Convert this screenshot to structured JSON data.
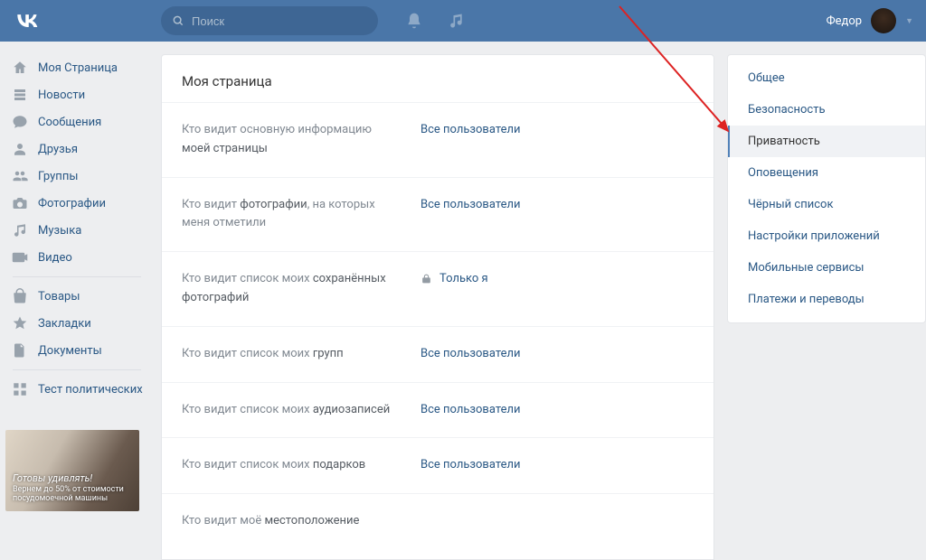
{
  "header": {
    "search_placeholder": "Поиск",
    "user_name": "Федор"
  },
  "left_nav": [
    {
      "id": "my-page",
      "label": "Моя Страница",
      "icon": "home"
    },
    {
      "id": "news",
      "label": "Новости",
      "icon": "feed"
    },
    {
      "id": "messages",
      "label": "Сообщения",
      "icon": "msg"
    },
    {
      "id": "friends",
      "label": "Друзья",
      "icon": "user"
    },
    {
      "id": "groups",
      "label": "Группы",
      "icon": "users"
    },
    {
      "id": "photos",
      "label": "Фотографии",
      "icon": "camera"
    },
    {
      "id": "music",
      "label": "Музыка",
      "icon": "music"
    },
    {
      "id": "videos",
      "label": "Видео",
      "icon": "video"
    }
  ],
  "left_nav2": [
    {
      "id": "market",
      "label": "Товары",
      "icon": "bag"
    },
    {
      "id": "bookmarks",
      "label": "Закладки",
      "icon": "star"
    },
    {
      "id": "docs",
      "label": "Документы",
      "icon": "doc"
    }
  ],
  "left_nav3": [
    {
      "id": "apptest",
      "label": "Тест политических",
      "icon": "apps"
    }
  ],
  "ad": {
    "title": "Готовы удивлять!",
    "subtitle": "Вернем до 50% от стоимости посудомоечной машины"
  },
  "main": {
    "title": "Моя страница",
    "rows": [
      {
        "label_pre": "Кто видит основную информацию ",
        "label_bold": "моей страницы",
        "value": "Все пользователи",
        "locked": false
      },
      {
        "label_pre": "Кто видит ",
        "label_bold": "фотографии",
        "label_post": ", на которых меня отметили",
        "value": "Все пользователи",
        "locked": false
      },
      {
        "label_pre": "Кто видит список моих ",
        "label_bold": "сохранённых фотографий",
        "value": "Только я",
        "locked": true
      },
      {
        "label_pre": "Кто видит список моих ",
        "label_bold": "групп",
        "value": "Все пользователи",
        "locked": false
      },
      {
        "label_pre": "Кто видит список моих ",
        "label_bold": "аудиозаписей",
        "value": "Все пользователи",
        "locked": false
      },
      {
        "label_pre": "Кто видит список моих ",
        "label_bold": "подарков",
        "value": "Все пользователи",
        "locked": false
      },
      {
        "label_pre": "Кто видит моё ",
        "label_bold": "местоположение",
        "value": "",
        "locked": false
      }
    ]
  },
  "right_nav": [
    {
      "id": "general",
      "label": "Общее",
      "active": false
    },
    {
      "id": "security",
      "label": "Безопасность",
      "active": false
    },
    {
      "id": "privacy",
      "label": "Приватность",
      "active": true
    },
    {
      "id": "notify",
      "label": "Оповещения",
      "active": false
    },
    {
      "id": "black",
      "label": "Чёрный список",
      "active": false
    },
    {
      "id": "appset",
      "label": "Настройки приложений",
      "active": false
    },
    {
      "id": "mobile",
      "label": "Мобильные сервисы",
      "active": false
    },
    {
      "id": "pay",
      "label": "Платежи и переводы",
      "active": false
    }
  ]
}
